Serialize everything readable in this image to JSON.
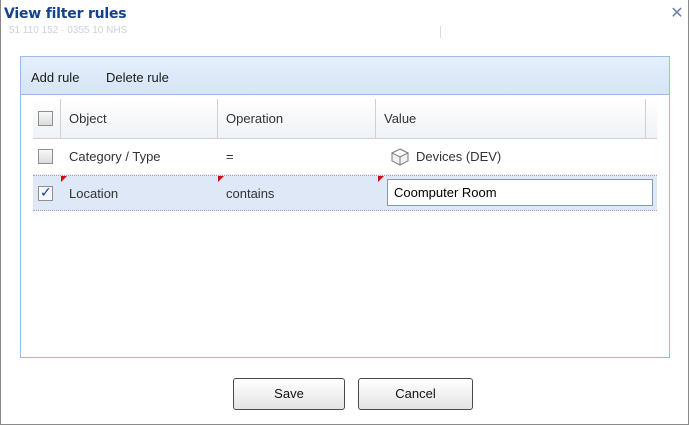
{
  "dialog": {
    "title": "View filter rules",
    "ghost_text": "51 110 152 · 0355 10 NHS",
    "close_glyph": "✕"
  },
  "toolbar": {
    "add_rule": "Add rule",
    "delete_rule": "Delete rule"
  },
  "grid": {
    "columns": [
      "Object",
      "Operation",
      "Value"
    ],
    "rows": [
      {
        "object": "Category / Type",
        "operation": "=",
        "value": "Devices (DEV)",
        "value_icon": "cube-icon",
        "checked": false,
        "selected": false
      },
      {
        "object": "Location",
        "operation": "contains",
        "value": "Coomputer Room",
        "checked": true,
        "selected": true
      }
    ]
  },
  "footer": {
    "save": "Save",
    "cancel": "Cancel"
  },
  "colors": {
    "title": "#15428b",
    "panel_border": "#99bbe8",
    "selected_row": "#dfe8f6",
    "dirty_marker": "#c81010"
  }
}
